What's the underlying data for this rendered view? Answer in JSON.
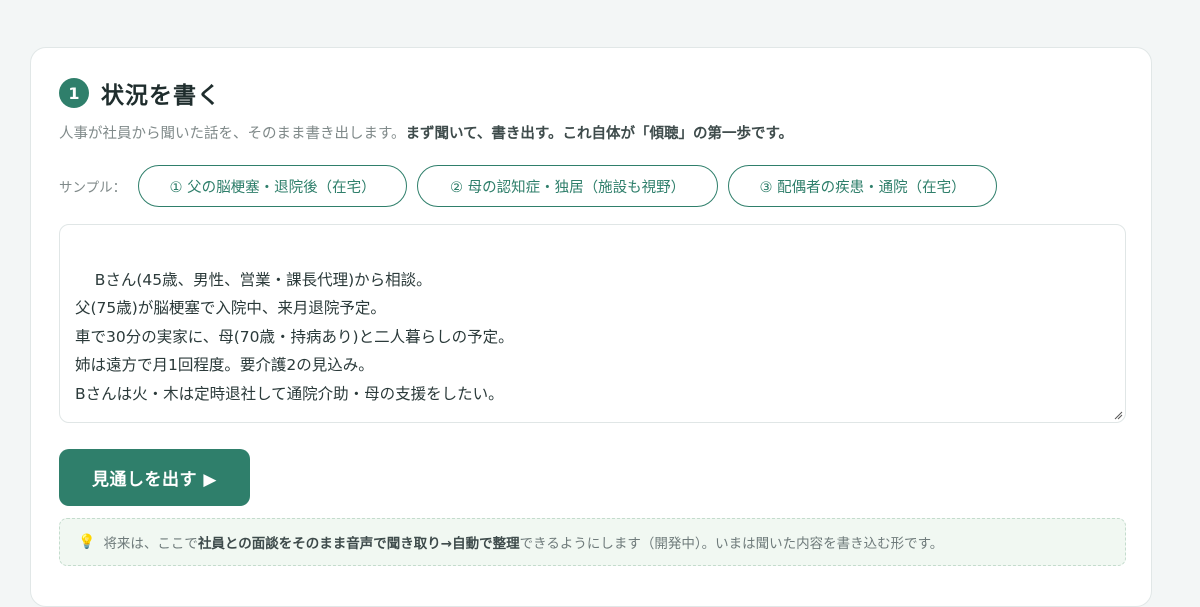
{
  "step": {
    "number": "1",
    "title": "状況を書く"
  },
  "description": {
    "part1": "人事が社員から聞いた話を、そのまま書き出します。",
    "strong": "まず聞いて、書き出す。これ自体が「傾聴」の第一歩です。"
  },
  "samples": {
    "label": "サンプル：",
    "items": [
      "① 父の脳梗塞・退院後（在宅）",
      "② 母の認知症・独居（施設も視野）",
      "③ 配偶者の疾患・通院（在宅）"
    ]
  },
  "input": {
    "value": "Bさん(45歳、男性、営業・課長代理)から相談。\n父(75歳)が脳梗塞で入院中、来月退院予定。\n車で30分の実家に、母(70歳・持病あり)と二人暮らしの予定。\n姉は遠方で月1回程度。要介護2の見込み。\nBさんは火・木は定時退社して通院介助・母の支援をしたい。"
  },
  "action": {
    "label": "見通しを出す ▶"
  },
  "note": {
    "icon": "lightbulb-icon",
    "part1": "将来は、ここで",
    "strong1": "社員との面談をそのまま音声で聞き取り→自動で整理",
    "part2": "できるようにします（開発中）。いまは聞いた内容を書き込む形です。"
  },
  "colors": {
    "accent": "#2f7f6b",
    "background": "#f3f6f6",
    "note_bg": "#f1f8f2"
  }
}
